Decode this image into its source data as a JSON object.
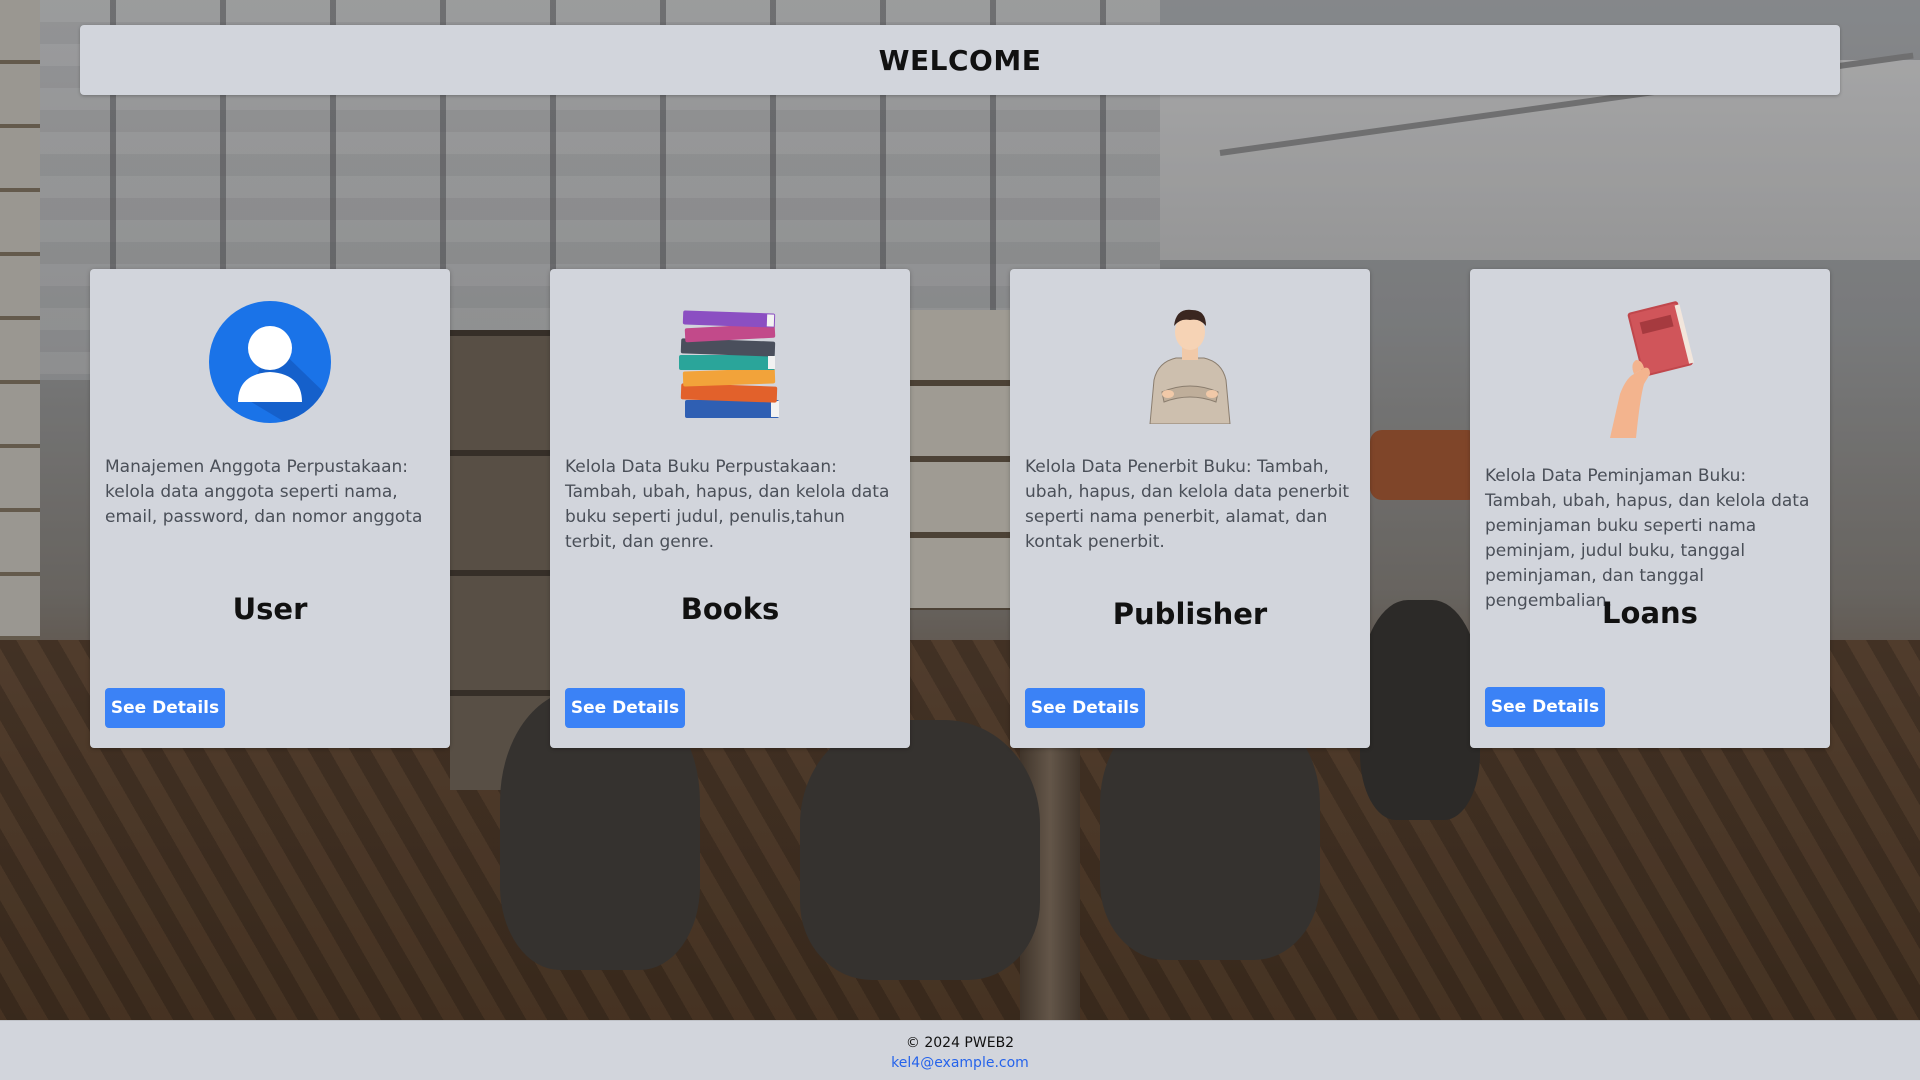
{
  "header": {
    "title": "WELCOME"
  },
  "cards": [
    {
      "icon": "user-avatar-icon",
      "description": "Manajemen Anggota Perpustakaan: kelola data anggota seperti nama, email, password, dan nomor anggota",
      "title": "User",
      "button": "See Details"
    },
    {
      "icon": "book-stack-icon",
      "description": "Kelola Data Buku Perpustakaan: Tambah, ubah, hapus, dan kelola data buku seperti judul, penulis,tahun terbit, dan genre.",
      "title": "Books",
      "button": "See Details"
    },
    {
      "icon": "person-arms-crossed-icon",
      "description": "Kelola Data Penerbit Buku: Tambah, ubah, hapus, dan kelola data penerbit seperti nama penerbit, alamat, dan kontak penerbit.",
      "title": "Publisher",
      "button": "See Details"
    },
    {
      "icon": "hand-holding-book-icon",
      "description": "Kelola Data Peminjaman Buku: Tambah, ubah, hapus, dan kelola data peminjaman buku seperti nama peminjam, judul buku, tanggal peminjaman, dan tanggal pengembalian.",
      "title": "Loans",
      "button": "See Details"
    }
  ],
  "footer": {
    "copyright": "© 2024 PWEB2",
    "email": "kel4@example.com"
  },
  "colors": {
    "button": "#3b82f6",
    "panel": "#d2d5dc",
    "link": "#2563eb"
  }
}
